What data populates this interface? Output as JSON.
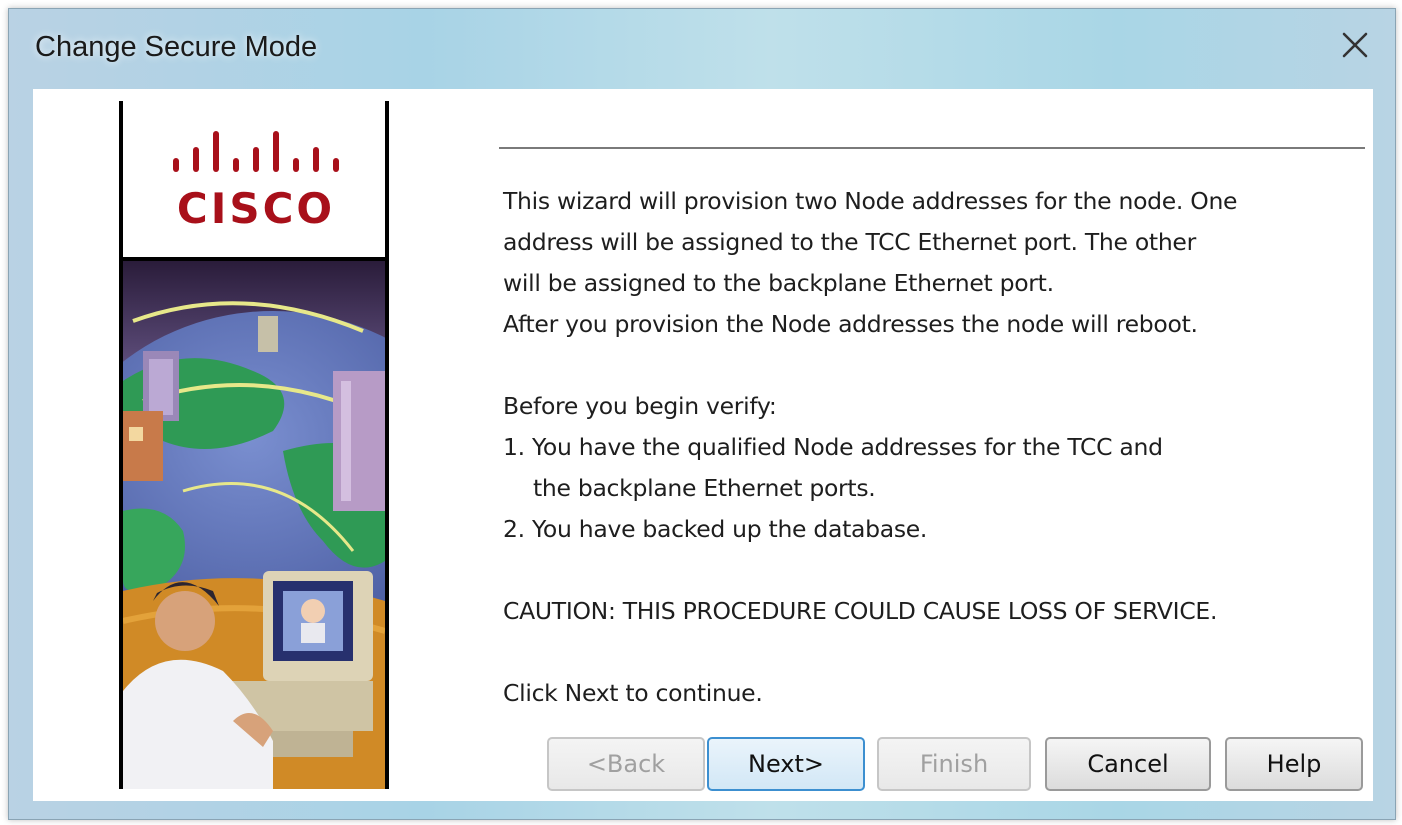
{
  "window": {
    "title": "Change Secure Mode"
  },
  "brand": {
    "logo_text": "CISCO"
  },
  "content": {
    "lines": [
      "This wizard will provision two Node addresses for the node. One",
      "address will be assigned to the TCC Ethernet port. The other",
      "will be assigned to the backplane Ethernet port.",
      "After you provision the Node addresses the node will reboot.",
      "",
      "Before you begin verify:",
      "1. You have the qualified Node addresses for the TCC and",
      "the backplane Ethernet ports.",
      "2. You have backed up the database.",
      "",
      "CAUTION: THIS PROCEDURE COULD CAUSE LOSS OF SERVICE.",
      "",
      "Click Next to continue."
    ]
  },
  "buttons": {
    "back": "<Back",
    "next": "Next>",
    "finish": "Finish",
    "cancel": "Cancel",
    "help": "Help"
  },
  "colors": {
    "logo_red": "#a8101a",
    "default_button_border": "#3c8fd0"
  },
  "icons": {
    "close": "close-icon"
  }
}
